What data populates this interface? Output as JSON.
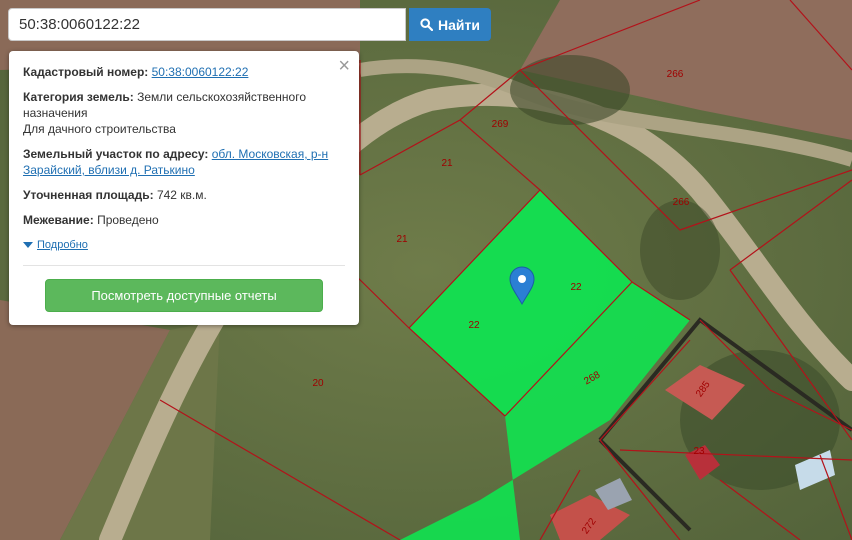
{
  "search": {
    "value": "50:38:0060122:22",
    "button_label": "Найти"
  },
  "popup": {
    "cadastral_label": "Кадастровый номер:",
    "cadastral_value": "50:38:0060122:22",
    "category_label": "Категория земель:",
    "category_value": "Земли сельскохозяйственного назначения",
    "category_use": "Для дачного строительства",
    "address_label": "Земельный участок по адресу:",
    "address_value": "обл. Московская, р-н Зарайский, вблизи д. Ратькино",
    "area_label": "Уточненная площадь:",
    "area_value": "742 кв.м.",
    "survey_label": "Межевание:",
    "survey_value": "Проведено",
    "more_label": "Подробно",
    "reports_button": "Посмотреть доступные отчеты"
  },
  "map": {
    "parcel_labels": [
      "266",
      "269",
      "21",
      "266",
      "21",
      "22",
      "22",
      "268",
      "285",
      "20",
      "23",
      "272"
    ],
    "highlight_color": "#12e050",
    "boundary_color": "#b3121a",
    "marker_color": "#2b7fd4"
  }
}
